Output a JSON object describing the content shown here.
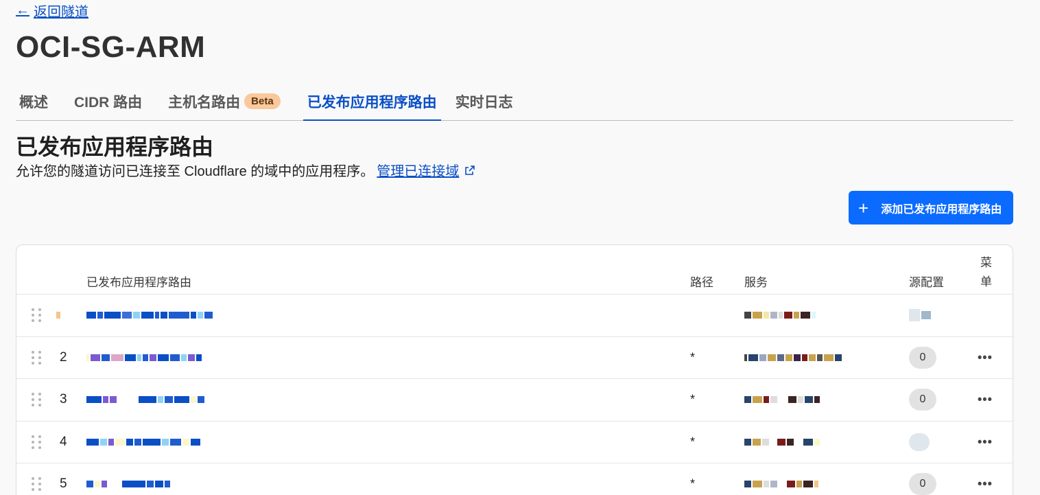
{
  "nav": {
    "back_label": "返回隧道"
  },
  "page": {
    "title": "OCI-SG-ARM"
  },
  "tabs": [
    {
      "label": "概述",
      "active": false
    },
    {
      "label": "CIDR 路由",
      "active": false
    },
    {
      "label": "主机名路由",
      "badge": "Beta",
      "active": false
    },
    {
      "label": "已发布应用程序路由",
      "active": true
    },
    {
      "label": "实时日志",
      "active": false
    }
  ],
  "section": {
    "title": "已发布应用程序路由",
    "description": "允许您的隧道访问已连接至 Cloudflare 的域中的应用程序。",
    "link_label": "管理已连接域"
  },
  "actions": {
    "add_label": "添加已发布应用程序路由"
  },
  "table": {
    "headers": {
      "route": "已发布应用程序路由",
      "path": "路径",
      "service": "服务",
      "origin": "源配置",
      "menu": "菜单"
    },
    "rows": [
      {
        "num": "",
        "path": "",
        "origin": "",
        "menu": ""
      },
      {
        "num": "2",
        "path": "*",
        "origin": "0",
        "menu": "•••"
      },
      {
        "num": "3",
        "path": "*",
        "origin": "0",
        "menu": "•••"
      },
      {
        "num": "4",
        "path": "*",
        "origin": "",
        "menu": "•••"
      },
      {
        "num": "5",
        "path": "*",
        "origin": "0",
        "menu": "•••"
      }
    ]
  },
  "colors": {
    "accent": "#0a4fc6",
    "primary_button": "#0b6bff",
    "badge": "#f9c89b"
  }
}
